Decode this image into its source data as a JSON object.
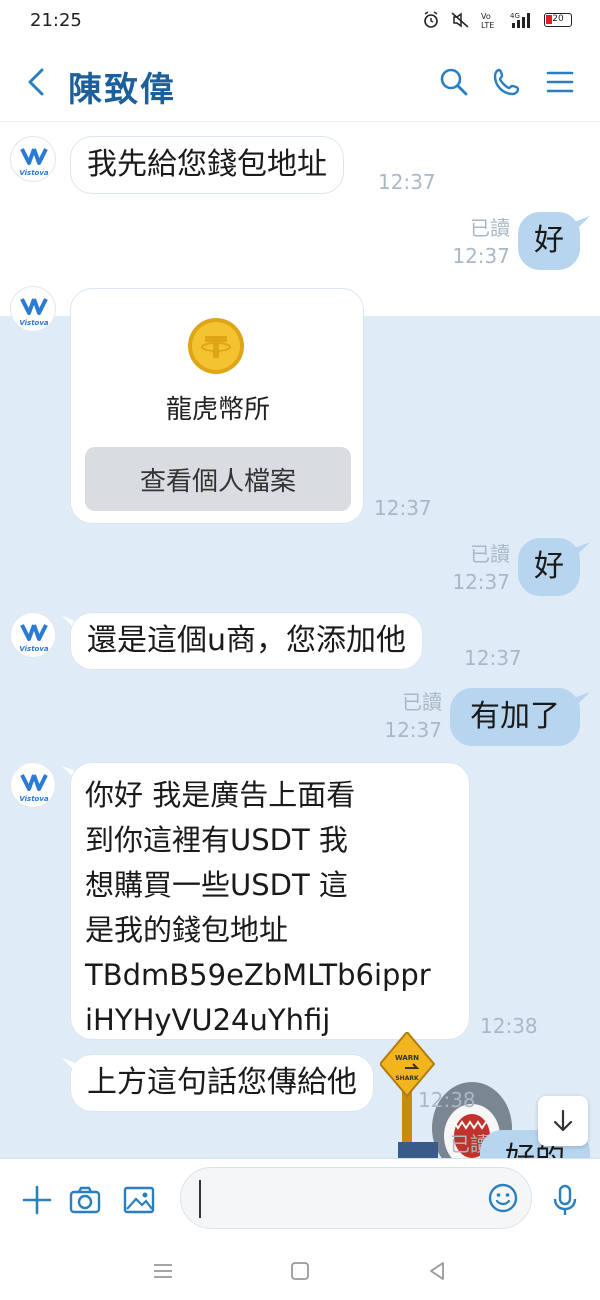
{
  "status_bar": {
    "time": "21:25",
    "icons": [
      "alarm-icon",
      "mute-icon",
      "volte-icon",
      "4g-signal-icon"
    ],
    "battery": "20"
  },
  "header": {
    "title": "陳致偉",
    "icons": [
      "back-icon",
      "search-icon",
      "phone-icon",
      "menu-icon"
    ]
  },
  "avatar_logo": "Vistova",
  "messages": [
    {
      "dir": "in",
      "text": "我先給您錢包地址",
      "time": "12:37"
    },
    {
      "dir": "out",
      "text": "好",
      "read": "已讀",
      "time": "12:37"
    },
    {
      "dir": "in",
      "type": "card",
      "name": "龍虎幣所",
      "button": "查看個人檔案",
      "time": "12:37"
    },
    {
      "dir": "out",
      "text": "好",
      "read": "已讀",
      "time": "12:37"
    },
    {
      "dir": "in",
      "text": "還是這個u商，您添加他",
      "time": "12:37"
    },
    {
      "dir": "out",
      "text": "有加了",
      "read": "已讀",
      "time": "12:37"
    },
    {
      "dir": "in",
      "lines": [
        "你好 我是廣告上面看",
        "到你這裡有USDT  我",
        "想購買一些USDT  這",
        "是我的錢包地址",
        "TBdmB59eZbMLTb6ippr",
        "iHYHyVU24uYhfij"
      ],
      "time": "12:38"
    },
    {
      "dir": "in",
      "text": "上方這句話您傳給他",
      "time": "12:38"
    }
  ],
  "partial_outgoing": {
    "read": "已讀",
    "text": "好的"
  },
  "sticker_text": {
    "sign_top": "WARN",
    "sign_bottom": "SHARK"
  },
  "input": {
    "value": "",
    "placeholder": ""
  },
  "colors": {
    "header_title": "#1d5f9a",
    "icon_blue": "#2a7fc0",
    "chat_bg": "#dfecf7",
    "out_bubble": "#b7d5ee",
    "meta": "#a9b8c6"
  }
}
